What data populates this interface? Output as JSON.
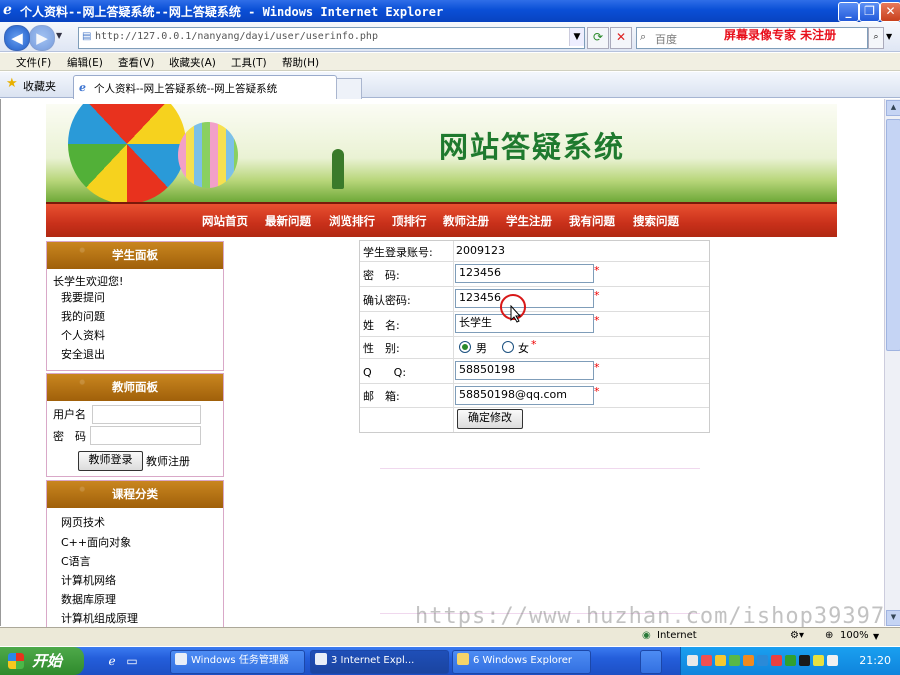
{
  "window": {
    "title": "个人资料--网上答疑系统--网上答疑系统 - Windows Internet Explorer",
    "minimize": "_",
    "restore": "❐",
    "close": "✕"
  },
  "browser": {
    "url": "http://127.0.0.1/nanyang/dayi/user/userinfo.php",
    "search_placeholder": "百度",
    "recorder_watermark": "屏幕录像专家 未注册",
    "menu": [
      "文件(F)",
      "编辑(E)",
      "查看(V)",
      "收藏夹(A)",
      "工具(T)",
      "帮助(H)"
    ],
    "favorites_label": "收藏夹",
    "tab_title": "个人资料--网上答疑系统--网上答疑系统"
  },
  "site": {
    "banner_title": "网站答疑系统",
    "nav": [
      "网站首页",
      "最新问题",
      "浏览排行",
      "顶排行",
      "教师注册",
      "学生注册",
      "我有问题",
      "搜索问题"
    ]
  },
  "student_panel": {
    "title": "学生面板",
    "welcome": "长学生欢迎您!",
    "links": [
      "我要提问",
      "我的问题",
      "个人资料",
      "安全退出"
    ]
  },
  "teacher_panel": {
    "title": "教师面板",
    "username_label": "用户名",
    "password_label": "密　码",
    "login_button": "教师登录",
    "register_link": "教师注册"
  },
  "course_panel": {
    "title": "课程分类",
    "items": [
      "网页技术",
      "C++面向对象",
      "C语言",
      "计算机网络",
      "数据库原理",
      "计算机组成原理"
    ]
  },
  "profile_form": {
    "account_label": "学生登录账号:",
    "account_value": "2009123",
    "password_label": "密　码:",
    "password_value": "123456",
    "confirm_label": "确认密码:",
    "confirm_value": "123456",
    "name_label": "姓　名:",
    "name_value": "长学生",
    "gender_label": "性　别:",
    "gender_male": "男",
    "gender_female": "女",
    "gender_selected": "男",
    "qq_label": "Q　　Q:",
    "qq_value": "58850198",
    "email_label": "邮　箱:",
    "email_value": "58850198@qq.com",
    "required_mark": "*",
    "submit_button": "确定修改"
  },
  "statusbar": {
    "zone": "Internet",
    "zoom": "100%",
    "overlay_url": "https://www.huzhan.com/ishop39397"
  },
  "taskbar": {
    "start": "开始",
    "buttons": [
      "Windows 任务管理器",
      "3 Internet Expl...",
      "6 Windows Explorer"
    ],
    "clock": "21:20"
  }
}
